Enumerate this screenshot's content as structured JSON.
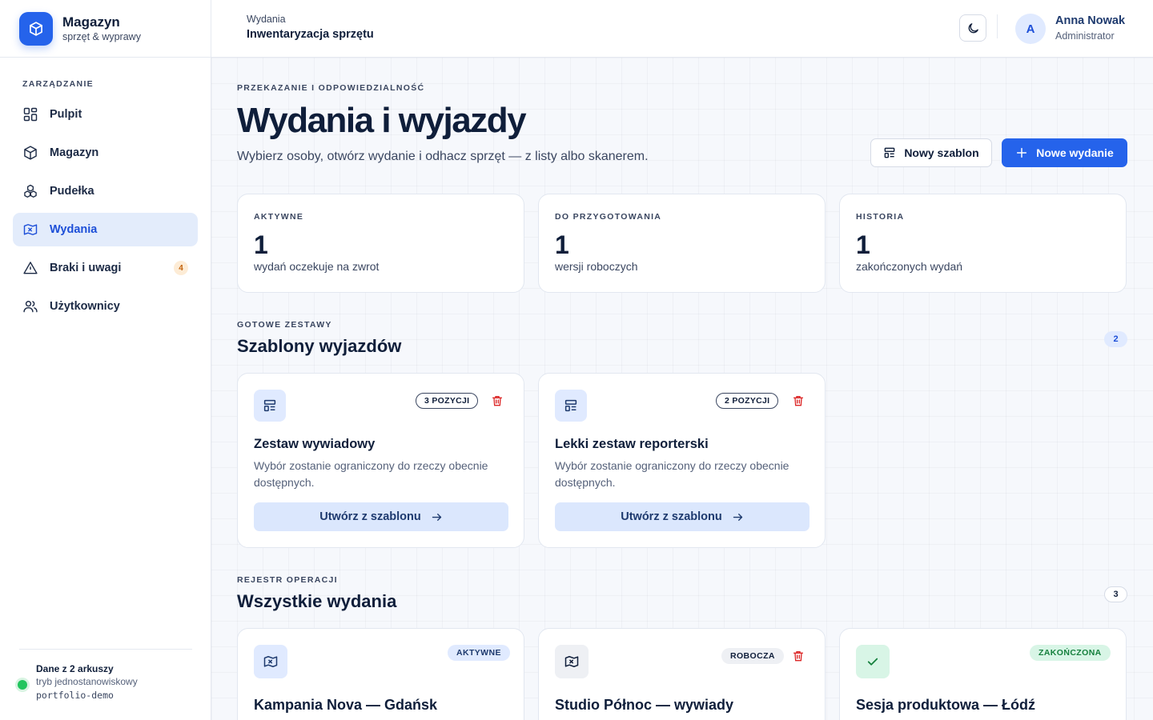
{
  "brand": {
    "name": "Magazyn",
    "subtitle": "sprzęt & wyprawy"
  },
  "sidebar": {
    "heading": "ZARZĄDZANIE",
    "items": [
      {
        "label": "Pulpit",
        "icon": "grid-icon"
      },
      {
        "label": "Magazyn",
        "icon": "box-icon"
      },
      {
        "label": "Pudełka",
        "icon": "boxes-icon"
      },
      {
        "label": "Wydania",
        "icon": "map-icon",
        "active": true
      },
      {
        "label": "Braki i uwagi",
        "icon": "alert-triangle-icon",
        "badge": "4"
      },
      {
        "label": "Użytkownicy",
        "icon": "users-icon"
      }
    ],
    "footer": {
      "title": "Dane z 2 arkuszy",
      "subtitle": "tryb jednostanowiskowy",
      "code": "portfolio-demo"
    }
  },
  "topbar": {
    "breadcrumb_section": "Wydania",
    "breadcrumb_page": "Inwentaryzacja sprzętu",
    "user": {
      "initial": "A",
      "name": "Anna Nowak",
      "role": "Administrator"
    }
  },
  "header": {
    "eyebrow": "PRZEKAZANIE I ODPOWIEDZIALNOŚĆ",
    "title": "Wydania i wyjazdy",
    "lead": "Wybierz osoby, otwórz wydanie i odhacz sprzęt — z listy albo skanerem.",
    "btn_template": "Nowy szablon",
    "btn_new": "Nowe wydanie"
  },
  "stats": [
    {
      "label": "AKTYWNE",
      "value": "1",
      "sub": "wydań oczekuje na zwrot"
    },
    {
      "label": "DO PRZYGOTOWANIA",
      "value": "1",
      "sub": "wersji roboczych"
    },
    {
      "label": "HISTORIA",
      "value": "1",
      "sub": "zakończonych wydań"
    }
  ],
  "templates": {
    "eyebrow": "GOTOWE ZESTAWY",
    "title": "Szablony wyjazdów",
    "count": "2",
    "items": [
      {
        "badge": "3 POZYCJI",
        "title": "Zestaw wywiadowy",
        "desc": "Wybór zostanie ograniczony do rzeczy obecnie dostępnych.",
        "button": "Utwórz z szablonu"
      },
      {
        "badge": "2 POZYCJI",
        "title": "Lekki zestaw reporterski",
        "desc": "Wybór zostanie ograniczony do rzeczy obecnie dostępnych.",
        "button": "Utwórz z szablonu"
      }
    ]
  },
  "operations": {
    "eyebrow": "REJESTR OPERACJI",
    "title": "Wszystkie wydania",
    "count": "3",
    "items": [
      {
        "status": "AKTYWNE",
        "title": "Kampania Nova — Gdańsk",
        "icon": "map-icon"
      },
      {
        "status": "ROBOCZA",
        "title": "Studio Północ — wywiady",
        "icon": "map-icon"
      },
      {
        "status": "ZAKOŃCZONA",
        "title": "Sesja produktowa — Łódź",
        "icon": "check-icon"
      }
    ]
  },
  "colors": {
    "accent": "#2563eb",
    "danger": "#dc2626",
    "success": "#22c55e",
    "warning": "#c2620b"
  }
}
